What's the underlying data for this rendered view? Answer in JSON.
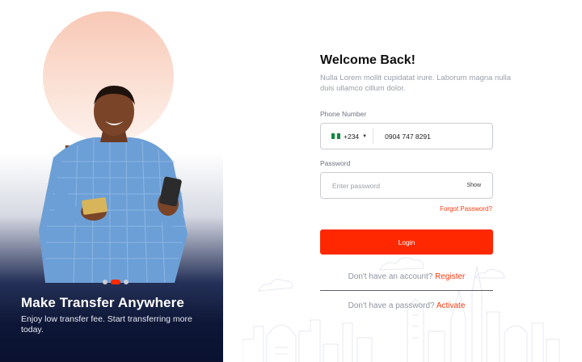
{
  "hero": {
    "title": "Make Transfer Anywhere",
    "subtitle": "Enjoy low transfer fee. Start transferring more today.",
    "carousel": {
      "count": 3,
      "active_index": 1
    }
  },
  "form": {
    "title": "Welcome Back!",
    "subtitle": "Nulla Lorem mollit cupidatat irure. Laborum magna nulla duis ullamco cillum dolor.",
    "phone": {
      "label": "Phone Number",
      "country_code": "+234",
      "value": "0904 747 8291"
    },
    "password": {
      "label": "Password",
      "placeholder": "Enter password",
      "show_label": "Show"
    },
    "forgot_label": "Forgot Password?",
    "login_label": "Login",
    "register_prompt": "Don't have an account?",
    "register_link": "Register",
    "activate_prompt": "Don't have a password?",
    "activate_link": "Activate"
  },
  "colors": {
    "accent": "#ff2800",
    "hero_dark": "#0d1636",
    "circle": "#f8c8b6"
  }
}
